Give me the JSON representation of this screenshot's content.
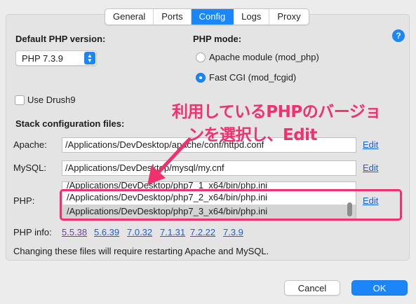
{
  "tabs": [
    {
      "label": "General",
      "active": false
    },
    {
      "label": "Ports",
      "active": false
    },
    {
      "label": "Config",
      "active": true
    },
    {
      "label": "Logs",
      "active": false
    },
    {
      "label": "Proxy",
      "active": false
    }
  ],
  "php_version": {
    "label": "Default PHP version:",
    "selected": "PHP 7.3.9"
  },
  "php_mode": {
    "label": "PHP mode:",
    "options": [
      {
        "label": "Apache module (mod_php)",
        "selected": false
      },
      {
        "label": "Fast CGI (mod_fcgid)",
        "selected": true
      }
    ]
  },
  "help_label": "?",
  "drush": {
    "label": "Use Drush9",
    "checked": false
  },
  "stack": {
    "heading": "Stack configuration files:",
    "apache": {
      "label": "Apache:",
      "value": "/Applications/DevDesktop/apache/conf/httpd.conf",
      "edit": "Edit"
    },
    "mysql": {
      "label": "MySQL:",
      "value": "/Applications/DevDesktop/mysql/my.cnf",
      "edit": "Edit"
    },
    "php": {
      "label": "PHP:",
      "rows": [
        "/Applications/DevDesktop/php7_1_x64/bin/php.ini",
        "/Applications/DevDesktop/php7_2_x64/bin/php.ini",
        "/Applications/DevDesktop/php7_3_x64/bin/php.ini"
      ],
      "edit": "Edit"
    }
  },
  "php_info": {
    "label": "PHP info:",
    "links": [
      "5.5.38",
      "5.6.39",
      "7.0.32",
      "7.1.31",
      "7.2.22",
      "7.3.9"
    ]
  },
  "notice": "Changing these files will require restarting Apache and MySQL.",
  "buttons": {
    "cancel": "Cancel",
    "ok": "OK"
  },
  "annotation": {
    "line1": "利用しているPHPのバージョ",
    "line2": "ンを選択し、Edit",
    "color": "#f0306f"
  },
  "colors": {
    "accent": "#1a86f7",
    "link": "#1a5fd4",
    "visited_link": "#6b3fa0"
  }
}
